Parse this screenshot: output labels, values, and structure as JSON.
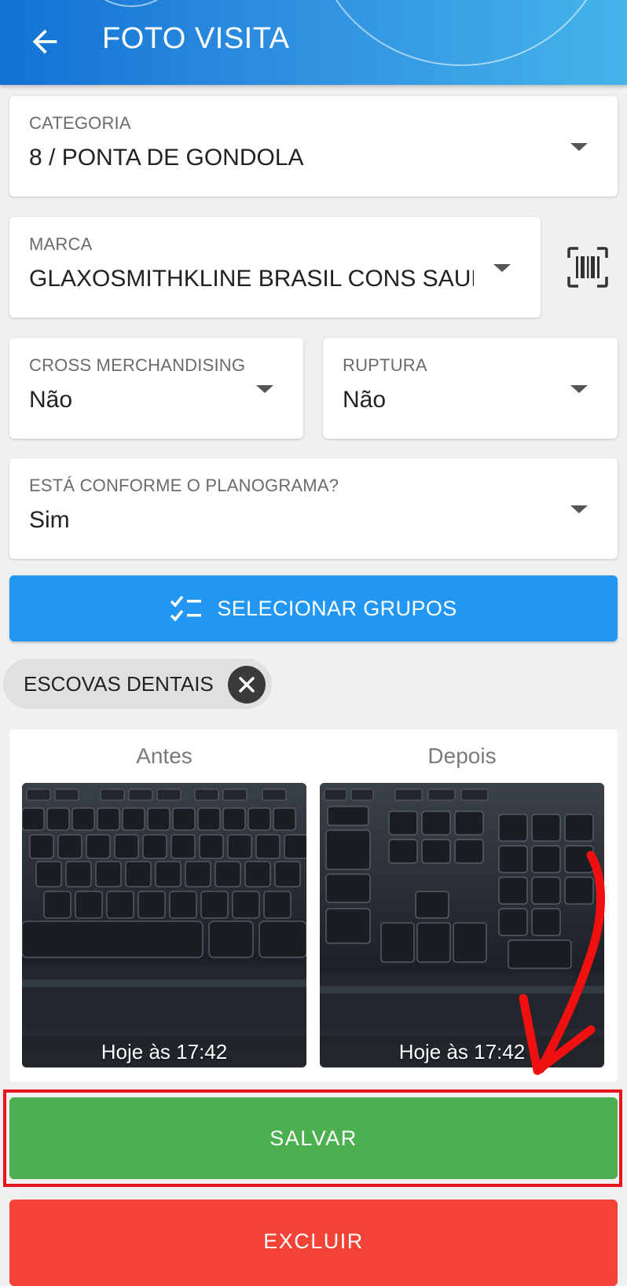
{
  "appbar": {
    "title": "FOTO VISITA",
    "back_icon": "arrow-left-icon",
    "color_start": "#1172d4",
    "color_end": "#45b4ea"
  },
  "form": {
    "categoria": {
      "label": "CATEGORIA",
      "value": "8 / PONTA DE GONDOLA"
    },
    "marca": {
      "label": "MARCA",
      "value": "GLAXOSMITHKLINE BRASIL CONS SAUDE",
      "scan_icon": "barcode-scan-icon"
    },
    "cross": {
      "label": "CROSS MERCHANDISING",
      "value": "Não"
    },
    "ruptura": {
      "label": "RUPTURA",
      "value": "Não"
    },
    "planograma": {
      "label": "ESTÁ CONFORME O PLANOGRAMA?",
      "value": "Sim"
    }
  },
  "groups_button": {
    "label": "SELECIONAR GRUPOS",
    "icon": "checklist-icon",
    "color": "#2196f3"
  },
  "chips": [
    {
      "label": "ESCOVAS DENTAIS",
      "close_icon": "close-icon"
    }
  ],
  "photos": [
    {
      "header": "Antes",
      "timestamp": "Hoje às 17:42"
    },
    {
      "header": "Depois",
      "timestamp": "Hoje às 17:42"
    }
  ],
  "actions": {
    "save_label": "SALVAR",
    "save_color": "#4caf50",
    "delete_label": "EXCLUIR",
    "delete_color": "#f44336"
  },
  "annotation": {
    "highlight_color": "#e8141c",
    "arrow_icon": "red-arrow-annotation"
  }
}
